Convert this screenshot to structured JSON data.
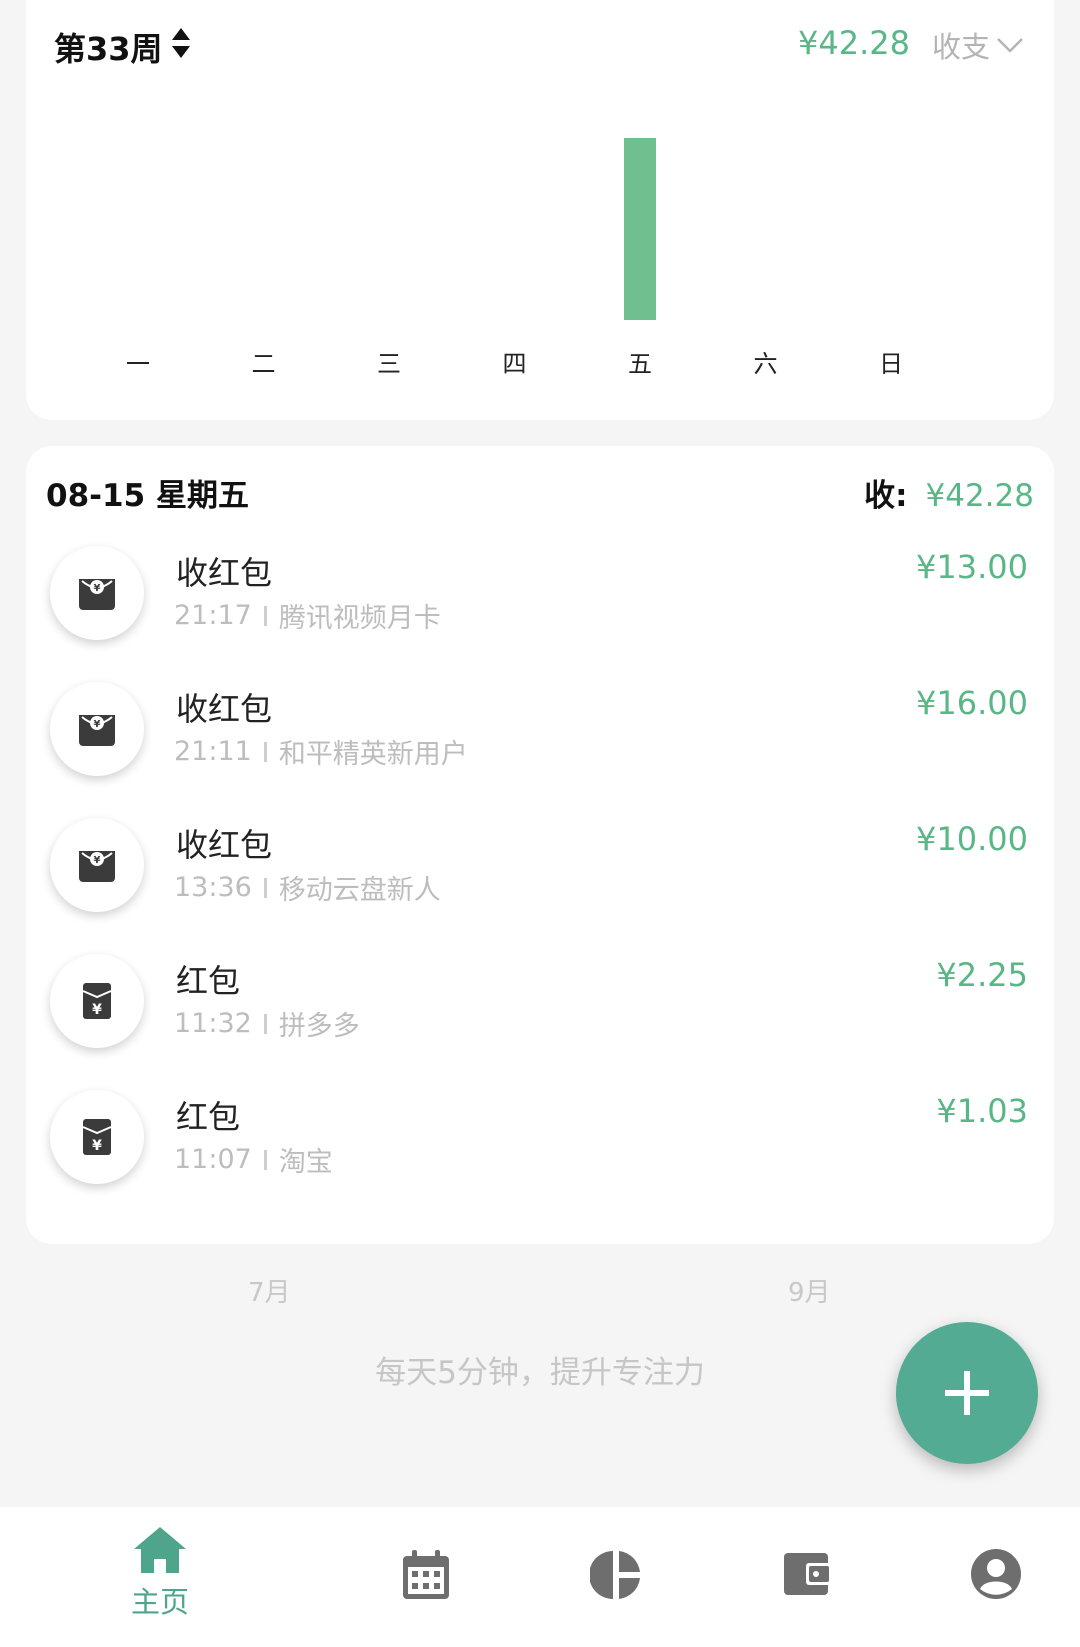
{
  "header": {
    "week_label": "第33周",
    "week_total": "¥42.28",
    "filter_label": "收支"
  },
  "chart_data": {
    "type": "bar",
    "categories": [
      "一",
      "二",
      "三",
      "四",
      "五",
      "六",
      "日"
    ],
    "values": [
      0,
      0,
      0,
      0,
      42.28,
      0,
      0
    ],
    "title": "",
    "xlabel": "",
    "ylabel": "",
    "grid": false,
    "colors": {
      "bar": "#6fbf8f"
    }
  },
  "day": {
    "date": "08-15 星期五",
    "income_label": "收:",
    "income_amount": "¥42.28",
    "transactions": [
      {
        "icon": "red-envelope-receive-icon",
        "title": "收红包",
        "time": "21:17",
        "note": "腾讯视频月卡",
        "amount": "¥13.00"
      },
      {
        "icon": "red-envelope-receive-icon",
        "title": "收红包",
        "time": "21:11",
        "note": "和平精英新用户",
        "amount": "¥16.00"
      },
      {
        "icon": "red-envelope-receive-icon",
        "title": "收红包",
        "time": "13:36",
        "note": "移动云盘新人",
        "amount": "¥10.00"
      },
      {
        "icon": "red-packet-icon",
        "title": "红包",
        "time": "11:32",
        "note": "拼多多",
        "amount": "¥2.25"
      },
      {
        "icon": "red-packet-icon",
        "title": "红包",
        "time": "11:07",
        "note": "淘宝",
        "amount": "¥1.03"
      }
    ]
  },
  "footer": {
    "prev_month": "7月",
    "next_month": "9月",
    "slogan": "每天5分钟，提升专注力"
  },
  "nav": {
    "items": [
      {
        "icon": "home-icon",
        "label": "主页",
        "active": true
      },
      {
        "icon": "calendar-icon",
        "label": "",
        "active": false
      },
      {
        "icon": "pie-chart-icon",
        "label": "",
        "active": false
      },
      {
        "icon": "wallet-icon",
        "label": "",
        "active": false
      },
      {
        "icon": "profile-icon",
        "label": "",
        "active": false
      }
    ]
  },
  "colors": {
    "accent": "#59b786",
    "fab": "#52ab92",
    "nav_active": "#4ea58b",
    "nav_inactive": "#6e6e6e"
  }
}
